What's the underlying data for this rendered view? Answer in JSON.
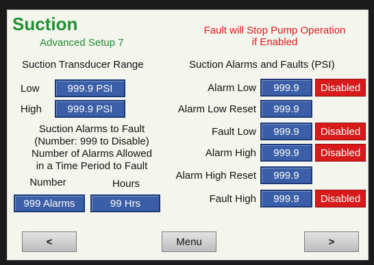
{
  "header": {
    "title": "Suction",
    "subtitle": "Advanced Setup 7",
    "warning_line1": "Fault will Stop Pump Operation",
    "warning_line2": "if Enabled"
  },
  "transducer": {
    "heading": "Suction Transducer Range",
    "low_label": "Low",
    "low_value": "999.9 PSI",
    "high_label": "High",
    "high_value": "999.9 PSI"
  },
  "alarms_to_fault": {
    "line1": "Suction Alarms to Fault",
    "line2": "(Number: 999 to Disable)",
    "line3": "Number of Alarms Allowed",
    "line4": "in a Time Period to Fault",
    "number_label": "Number",
    "hours_label": "Hours",
    "number_value": "999 Alarms",
    "hours_value": "99 Hrs"
  },
  "alarms_faults": {
    "heading": "Suction Alarms and Faults (PSI)",
    "rows": [
      {
        "label": "Alarm Low",
        "value": "999.9",
        "status": "Disabled"
      },
      {
        "label": "Alarm Low Reset",
        "value": "999.9"
      },
      {
        "label": "Fault Low",
        "value": "999.9",
        "status": "Disabled"
      },
      {
        "label": "Alarm High",
        "value": "999.9",
        "status": "Disabled"
      },
      {
        "label": "Alarm High Reset",
        "value": "999.9"
      },
      {
        "label": "Fault High",
        "value": "999.9",
        "status": "Disabled"
      }
    ]
  },
  "nav": {
    "prev": "<",
    "menu": "Menu",
    "next": ">"
  },
  "colors": {
    "title_green": "#1f8f2f",
    "warning_red": "#e8151b",
    "field_blue": "#3a5fa8",
    "disabled_red": "#d91a1a"
  }
}
